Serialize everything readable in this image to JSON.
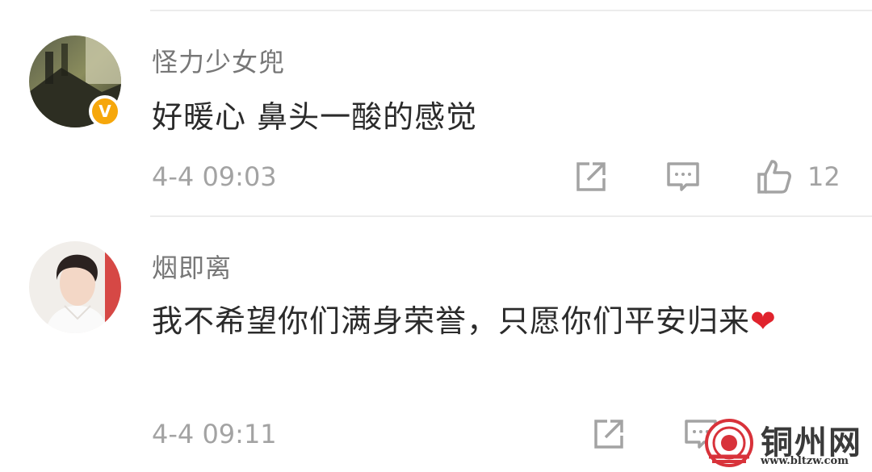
{
  "comments": [
    {
      "username": "怪力少女兜",
      "text": "好暖心 鼻头一酸的感觉",
      "time": "4-4 09:03",
      "likes": "12",
      "verified": true
    },
    {
      "username": "烟即离",
      "text": "我不希望你们满身荣誉，只愿你们平安归来",
      "emoji": "❤",
      "time": "4-4 09:11"
    }
  ],
  "icons": [
    "share-icon",
    "reply-icon",
    "like-icon",
    "verified-badge-icon"
  ],
  "colors": {
    "username": "#777777",
    "text": "#2b2b2b",
    "meta": "#a3a3a3",
    "badge": "#f6a70b",
    "heart": "#e0232d",
    "watermark_red": "#d8323a"
  },
  "watermark": {
    "title": "铜州网",
    "url": "www.bltzw.com"
  }
}
